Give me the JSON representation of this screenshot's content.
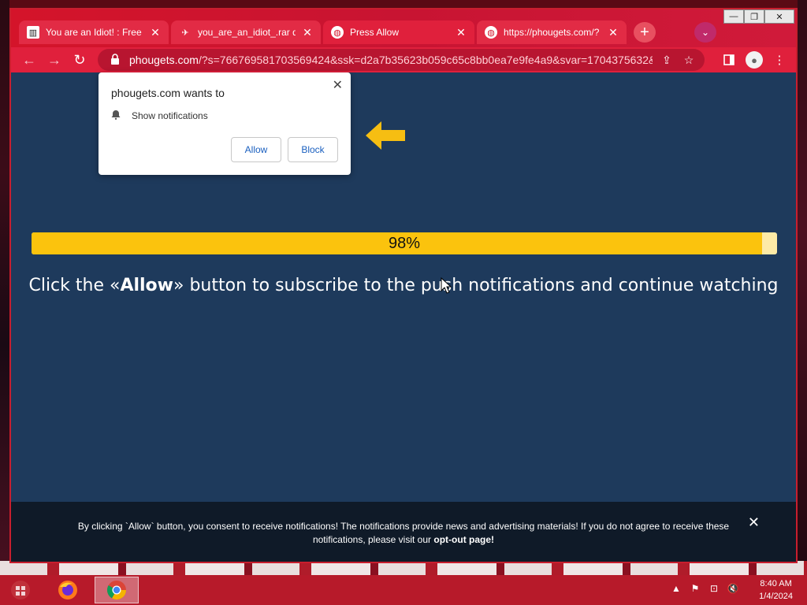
{
  "window": {
    "minimize_glyph": "—",
    "restore_glyph": "❐",
    "close_glyph": "✕"
  },
  "tabs": [
    {
      "title": "You are an Idiot! : Free D",
      "icon": "museum-icon",
      "close": "✕"
    },
    {
      "title": "you_are_an_idiot_.rar de",
      "icon": "plane-icon",
      "close": "✕"
    },
    {
      "title": "Press Allow",
      "icon": "globe-icon",
      "close": "✕"
    },
    {
      "title": "https://phougets.com/?",
      "icon": "globe-icon",
      "close": "✕"
    }
  ],
  "new_tab_glyph": "+",
  "tab_search_glyph": "⌄",
  "toolbar": {
    "back": "←",
    "forward": "→",
    "reload": "↻",
    "url_domain": "phougets.com",
    "url_rest": "/?s=766769581703569424&ssk=d2a7b35623b059c65c8bb0ea7e9fe4a9&svar=1704375632&...",
    "share_glyph": "⇪",
    "star_glyph": "☆",
    "menu_glyph": "⋮"
  },
  "permission_popup": {
    "title": "phougets.com wants to",
    "permission": "Show notifications",
    "allow_label": "Allow",
    "block_label": "Block",
    "close_glyph": "✕"
  },
  "progress": {
    "value": 98,
    "label": "98%"
  },
  "headline": {
    "before": "Click the «",
    "bold": "Allow",
    "after": "» button to subscribe to the push notifications and continue watching"
  },
  "consent": {
    "text": "By clicking `Allow` button, you consent to receive notifications! The notifications provide news and advertising materials! If you do not agree to receive these notifications, please visit our ",
    "link": "opt-out page!",
    "close_glyph": "✕"
  },
  "taskbar": {
    "apps": [
      "firefox",
      "chrome"
    ],
    "tray_up": "▲",
    "tray_flag": "⚑",
    "tray_network": "⊡",
    "tray_volume": "🔇",
    "time": "8:40 AM",
    "date": "1/4/2024"
  },
  "colors": {
    "accent_red": "#e0203c",
    "page_bg": "#1e3a5c",
    "progress_fill": "#fbc30d",
    "progress_track": "#fdeaa6",
    "arrow": "#f6be12"
  }
}
